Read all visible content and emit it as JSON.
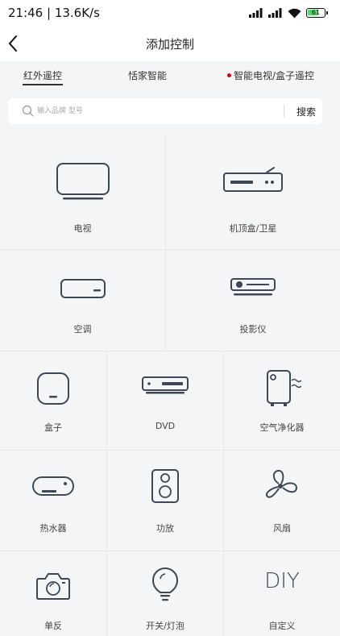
{
  "status_bar": {
    "time_speed": "21:46 | 13.6K/s",
    "battery": "61"
  },
  "nav": {
    "title": "添加控制"
  },
  "tabs": [
    {
      "label": "红外遥控",
      "active": true
    },
    {
      "label": "恬家智能",
      "active": false
    },
    {
      "label": "智能电视/盒子遥控",
      "active": false,
      "red_dot": true
    }
  ],
  "search": {
    "placeholder": "输入品牌 型号",
    "button_label": "搜索"
  },
  "devices": [
    {
      "label": "电视",
      "icon": "tv-icon"
    },
    {
      "label": "机顶盒/卫星",
      "icon": "set-top-box-icon"
    },
    {
      "label": "空调",
      "icon": "air-conditioner-icon"
    },
    {
      "label": "投影仪",
      "icon": "projector-icon"
    },
    {
      "label": "盒子",
      "icon": "box-icon"
    },
    {
      "label": "DVD",
      "icon": "dvd-icon"
    },
    {
      "label": "空气净化器",
      "icon": "air-purifier-icon"
    },
    {
      "label": "热水器",
      "icon": "water-heater-icon"
    },
    {
      "label": "功放",
      "icon": "amplifier-icon"
    },
    {
      "label": "风扇",
      "icon": "fan-icon"
    },
    {
      "label": "单反",
      "icon": "camera-icon"
    },
    {
      "label": "开关/灯泡",
      "icon": "bulb-icon"
    },
    {
      "label": "自定义",
      "icon": "diy-icon",
      "icon_text": "DIY"
    }
  ],
  "colors": {
    "icon_stroke": "#3d4756",
    "red_dot": "#d9001b",
    "battery_fill": "#4cd964"
  }
}
